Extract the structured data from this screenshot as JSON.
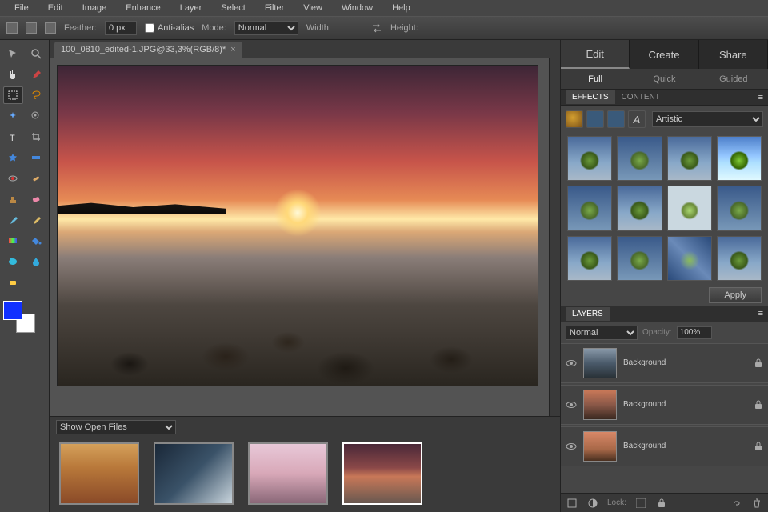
{
  "menu": [
    "File",
    "Edit",
    "Image",
    "Enhance",
    "Layer",
    "Select",
    "Filter",
    "View",
    "Window",
    "Help"
  ],
  "optionsBar": {
    "feather_label": "Feather:",
    "feather_value": "0 px",
    "antialias_label": "Anti-alias",
    "mode_label": "Mode:",
    "mode_value": "Normal",
    "width_label": "Width:",
    "height_label": "Height:"
  },
  "document": {
    "tab_title": "100_0810_edited-1.JPG@33,3%(RGB/8)*"
  },
  "openFiles": {
    "dropdown": "Show Open Files"
  },
  "rightTabs": {
    "edit": "Edit",
    "create": "Create",
    "share": "Share"
  },
  "editSubTabs": {
    "full": "Full",
    "quick": "Quick",
    "guided": "Guided"
  },
  "effectsPanel": {
    "tab_effects": "EFFECTS",
    "tab_content": "CONTENT",
    "category": "Artistic",
    "apply": "Apply"
  },
  "layersPanel": {
    "title": "LAYERS",
    "blend": "Normal",
    "opacity_label": "Opacity:",
    "opacity_value": "100%",
    "lock_label": "Lock:",
    "items": [
      {
        "name": "Background"
      },
      {
        "name": "Background"
      },
      {
        "name": "Background"
      }
    ]
  },
  "tools": [
    [
      "move",
      "zoom"
    ],
    [
      "hand",
      "eyedropper"
    ],
    [
      "marquee",
      "lasso"
    ],
    [
      "magic-wand",
      "quick-select"
    ],
    [
      "type",
      "crop"
    ],
    [
      "cookie-cutter",
      "straighten"
    ],
    [
      "red-eye",
      "healing"
    ],
    [
      "clone",
      "eraser"
    ],
    [
      "brush",
      "pencil"
    ],
    [
      "gradient",
      "paint-bucket"
    ],
    [
      "shape",
      "blur"
    ],
    [
      "sponge",
      ""
    ]
  ],
  "colors": {
    "foreground": "#1030ff",
    "background": "#ffffff"
  }
}
